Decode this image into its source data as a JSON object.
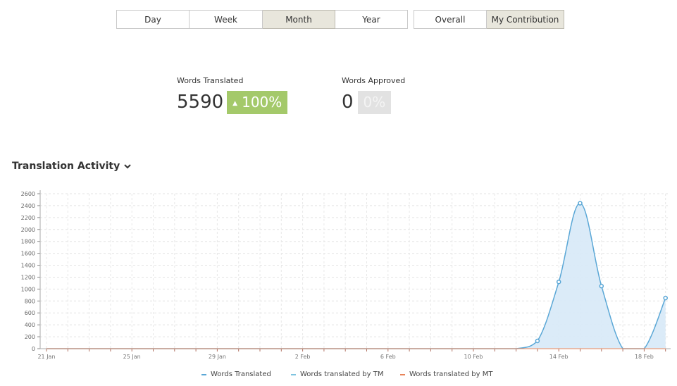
{
  "period_tabs": [
    {
      "label": "Day",
      "active": false
    },
    {
      "label": "Week",
      "active": false
    },
    {
      "label": "Month",
      "active": true
    },
    {
      "label": "Year",
      "active": false
    }
  ],
  "scope_tabs": [
    {
      "label": "Overall",
      "active": false
    },
    {
      "label": "My Contribution",
      "active": true
    }
  ],
  "stats": {
    "translated": {
      "label": "Words Translated",
      "value": "5590",
      "change": "100%",
      "trend": "up"
    },
    "approved": {
      "label": "Words Approved",
      "value": "0",
      "change": "0%"
    }
  },
  "section": {
    "title": "Translation Activity",
    "icon": "chevron-down-icon"
  },
  "colors": {
    "accent_green": "#a4c96a",
    "series_translated": "#5aa7d6",
    "series_tm": "#7fc4e0",
    "series_mt": "#e8845a",
    "area_fill": "#d7e9f7"
  },
  "chart_data": {
    "type": "area",
    "x": [
      "21 Jan",
      "22 Jan",
      "23 Jan",
      "24 Jan",
      "25 Jan",
      "26 Jan",
      "27 Jan",
      "28 Jan",
      "29 Jan",
      "30 Jan",
      "31 Jan",
      "1 Feb",
      "2 Feb",
      "3 Feb",
      "4 Feb",
      "5 Feb",
      "6 Feb",
      "7 Feb",
      "8 Feb",
      "9 Feb",
      "10 Feb",
      "11 Feb",
      "12 Feb",
      "13 Feb",
      "14 Feb",
      "15 Feb",
      "16 Feb",
      "17 Feb",
      "18 Feb",
      "19 Feb"
    ],
    "x_tick_labels": [
      "21 Jan",
      "25 Jan",
      "29 Jan",
      "2 Feb",
      "6 Feb",
      "10 Feb",
      "14 Feb",
      "18 Feb"
    ],
    "ylim": [
      0,
      2600
    ],
    "y_ticks": [
      0,
      200,
      400,
      600,
      800,
      1000,
      1200,
      1400,
      1600,
      1800,
      2000,
      2200,
      2400,
      2600
    ],
    "grid": true,
    "legend_position": "bottom",
    "series": [
      {
        "name": "Words Translated",
        "values": [
          0,
          0,
          0,
          0,
          0,
          0,
          0,
          0,
          0,
          0,
          0,
          0,
          0,
          0,
          0,
          0,
          0,
          0,
          0,
          0,
          0,
          0,
          0,
          130,
          1120,
          2440,
          1050,
          0,
          0,
          850
        ]
      },
      {
        "name": "Words translated by TM",
        "values": [
          0,
          0,
          0,
          0,
          0,
          0,
          0,
          0,
          0,
          0,
          0,
          0,
          0,
          0,
          0,
          0,
          0,
          0,
          0,
          0,
          0,
          0,
          0,
          0,
          0,
          0,
          0,
          0,
          0,
          0
        ]
      },
      {
        "name": "Words translated by MT",
        "values": [
          0,
          0,
          0,
          0,
          0,
          0,
          0,
          0,
          0,
          0,
          0,
          0,
          0,
          0,
          0,
          0,
          0,
          0,
          0,
          0,
          0,
          0,
          0,
          0,
          0,
          0,
          0,
          0,
          0,
          0
        ]
      }
    ]
  }
}
